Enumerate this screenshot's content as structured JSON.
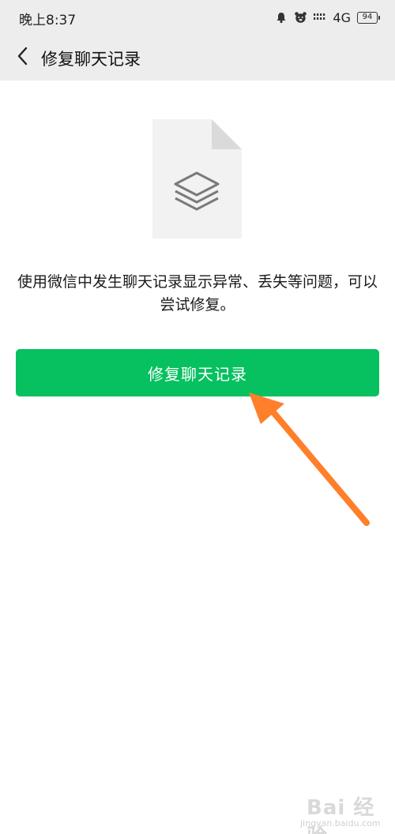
{
  "status_bar": {
    "time": "晚上8:37",
    "network": "4G",
    "battery": "94",
    "icons": [
      "alarm-icon",
      "pet-icon",
      "signal-icon"
    ]
  },
  "nav": {
    "back_icon": "chevron-left-icon",
    "title": "修复聊天记录"
  },
  "main": {
    "illustration_icon": "layers-file-icon",
    "description": "使用微信中发生聊天记录显示异常、丢失等问题，可以尝试修复。",
    "button_label": "修复聊天记录"
  },
  "colors": {
    "accent": "#07c160",
    "header_bg": "#ededed",
    "annotation_arrow": "#ff7f2a"
  },
  "watermark": {
    "brand": "Bai  经验",
    "url": "jingyan.baidu.com"
  }
}
